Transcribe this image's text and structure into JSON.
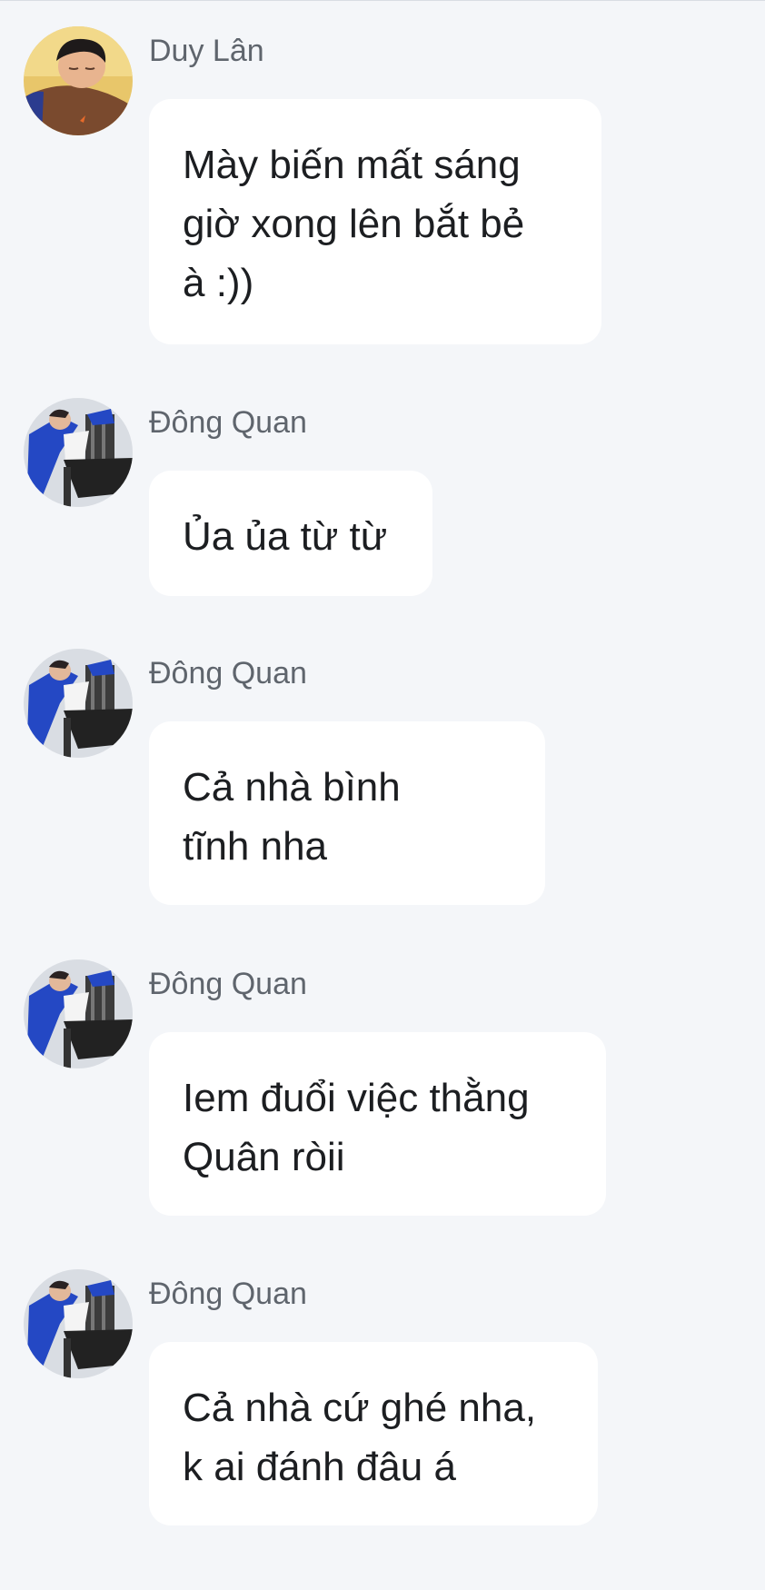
{
  "messages": [
    {
      "sender": "Duy Lân",
      "avatar": "profile-photo-duy-lan",
      "text": "Mày biến mất sáng\ngiờ xong lên bắt bẻ\nà :))"
    },
    {
      "sender": "Đông Quan",
      "avatar": "profile-photo-dong-quan",
      "text": "Ủa ủa từ từ"
    },
    {
      "sender": "Đông Quan",
      "avatar": "profile-photo-dong-quan",
      "text": "Cả nhà bình\ntĩnh nha"
    },
    {
      "sender": "Đông Quan",
      "avatar": "profile-photo-dong-quan",
      "text": "Iem đuổi việc thằng\nQuân ròii"
    },
    {
      "sender": "Đông Quan",
      "avatar": "profile-photo-dong-quan",
      "text": "Cả nhà cứ ghé nha,\nk ai đánh đâu á"
    }
  ]
}
